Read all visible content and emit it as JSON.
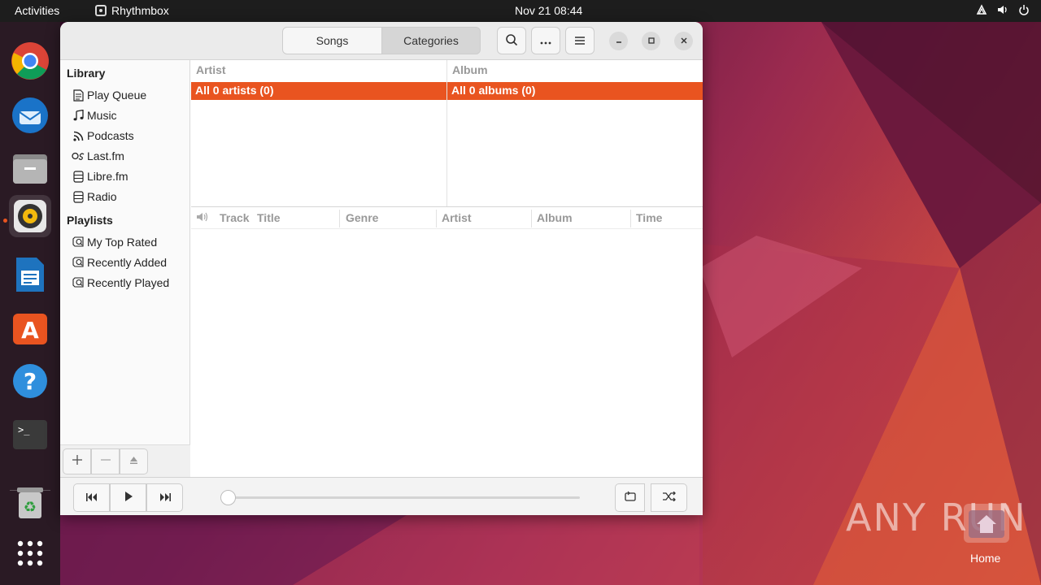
{
  "topbar": {
    "activities": "Activities",
    "app_name": "Rhythmbox",
    "clock": "Nov 21  08:44"
  },
  "dock": {
    "items": [
      "chrome-icon",
      "thunderbird-icon",
      "files-icon",
      "rhythmbox-icon",
      "libreoffice-writer-icon",
      "app-center-icon",
      "help-icon",
      "terminal-icon",
      "trash-icon",
      "show-apps-icon"
    ]
  },
  "window": {
    "view_switcher": {
      "songs": "Songs",
      "categories": "Categories"
    },
    "sidebar": {
      "library_title": "Library",
      "library_items": [
        {
          "label": "Play Queue",
          "icon": "document-icon"
        },
        {
          "label": "Music",
          "icon": "music-note-icon"
        },
        {
          "label": "Podcasts",
          "icon": "rss-icon"
        },
        {
          "label": "Last.fm",
          "icon": "lastfm-icon"
        },
        {
          "label": "Libre.fm",
          "icon": "server-icon"
        },
        {
          "label": "Radio",
          "icon": "radio-icon"
        }
      ],
      "playlists_title": "Playlists",
      "playlist_items": [
        {
          "label": "My Top Rated",
          "icon": "smart-playlist-icon"
        },
        {
          "label": "Recently Added",
          "icon": "smart-playlist-icon"
        },
        {
          "label": "Recently Played",
          "icon": "smart-playlist-icon"
        }
      ]
    },
    "browser": {
      "artist_header": "Artist",
      "album_header": "Album",
      "artist_all": "All 0 artists (0)",
      "album_all": "All 0 albums (0)"
    },
    "tracklist": {
      "columns": [
        "Track",
        "Title",
        "Genre",
        "Artist",
        "Album",
        "Time"
      ]
    }
  },
  "desktop": {
    "watermark": "ANY RUN",
    "home_label": "Home"
  },
  "colors": {
    "accent": "#e95420",
    "topbar": "#1d1d1d"
  }
}
